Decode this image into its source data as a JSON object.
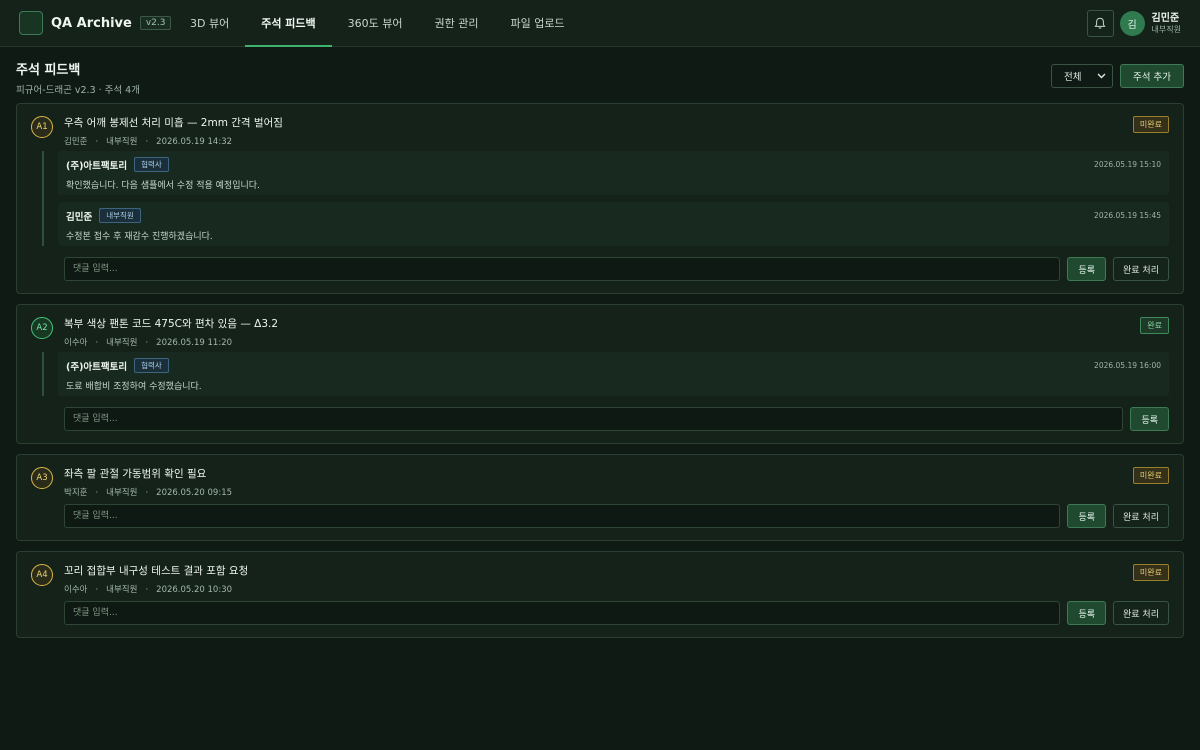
{
  "app": {
    "title": "QA Archive",
    "version": "v2.3"
  },
  "nav": {
    "tabs": [
      {
        "label": "3D 뷰어",
        "active": false
      },
      {
        "label": "주석 피드백",
        "active": true
      },
      {
        "label": "360도 뷰어",
        "active": false
      },
      {
        "label": "권한 관리",
        "active": false
      },
      {
        "label": "파일 업로드",
        "active": false
      }
    ]
  },
  "user": {
    "avatar_initial": "김",
    "name": "김민준",
    "role": "내부직원"
  },
  "page": {
    "title": "주석 피드백",
    "subtitle": "피규어-드래곤 v2.3 · 주석 4개",
    "filter_value": "전체",
    "add_button": "주석 추가"
  },
  "icons": {
    "bell": "bell-icon",
    "chevron": "chevron-down-icon"
  },
  "colors": {
    "accent": "#3fb26b",
    "pending": "#e8ce6e",
    "done": "#8ed8a8"
  },
  "annotations": [
    {
      "id": "A1",
      "done": false,
      "title": "우측 어깨 봉제선 처리 미흡 — 2mm 간격 벌어짐",
      "author": "김민준",
      "role": "내부직원",
      "time": "2026.05.19 14:32",
      "status": "미완료",
      "replies": [
        {
          "author": "(주)아트팩토리",
          "tag": "협력사",
          "time": "2026.05.19 15:10",
          "text": "확인했습니다. 다음 샘플에서 수정 적용 예정입니다."
        },
        {
          "author": "김민준",
          "tag": "내부직원",
          "time": "2026.05.19 15:45",
          "text": "수정본 접수 후 재감수 진행하겠습니다."
        }
      ],
      "placeholder": "댓글 입력...",
      "register": "등록",
      "complete": "완료 처리"
    },
    {
      "id": "A2",
      "done": true,
      "title": "복부 색상 팬톤 코드 475C와 편차 있음 — Δ3.2",
      "author": "이수아",
      "role": "내부직원",
      "time": "2026.05.19 11:20",
      "status": "완료",
      "replies": [
        {
          "author": "(주)아트팩토리",
          "tag": "협력사",
          "time": "2026.05.19 16:00",
          "text": "도료 배합비 조정하여 수정했습니다."
        }
      ],
      "placeholder": "댓글 입력...",
      "register": "등록",
      "complete": ""
    },
    {
      "id": "A3",
      "done": false,
      "title": "좌측 팔 관절 가동범위 확인 필요",
      "author": "박지훈",
      "role": "내부직원",
      "time": "2026.05.20 09:15",
      "status": "미완료",
      "replies": [],
      "placeholder": "댓글 입력...",
      "register": "등록",
      "complete": "완료 처리"
    },
    {
      "id": "A4",
      "done": false,
      "title": "꼬리 접합부 내구성 테스트 결과 포함 요청",
      "author": "이수아",
      "role": "내부직원",
      "time": "2026.05.20 10:30",
      "status": "미완료",
      "replies": [],
      "placeholder": "댓글 입력...",
      "register": "등록",
      "complete": "완료 처리"
    }
  ]
}
